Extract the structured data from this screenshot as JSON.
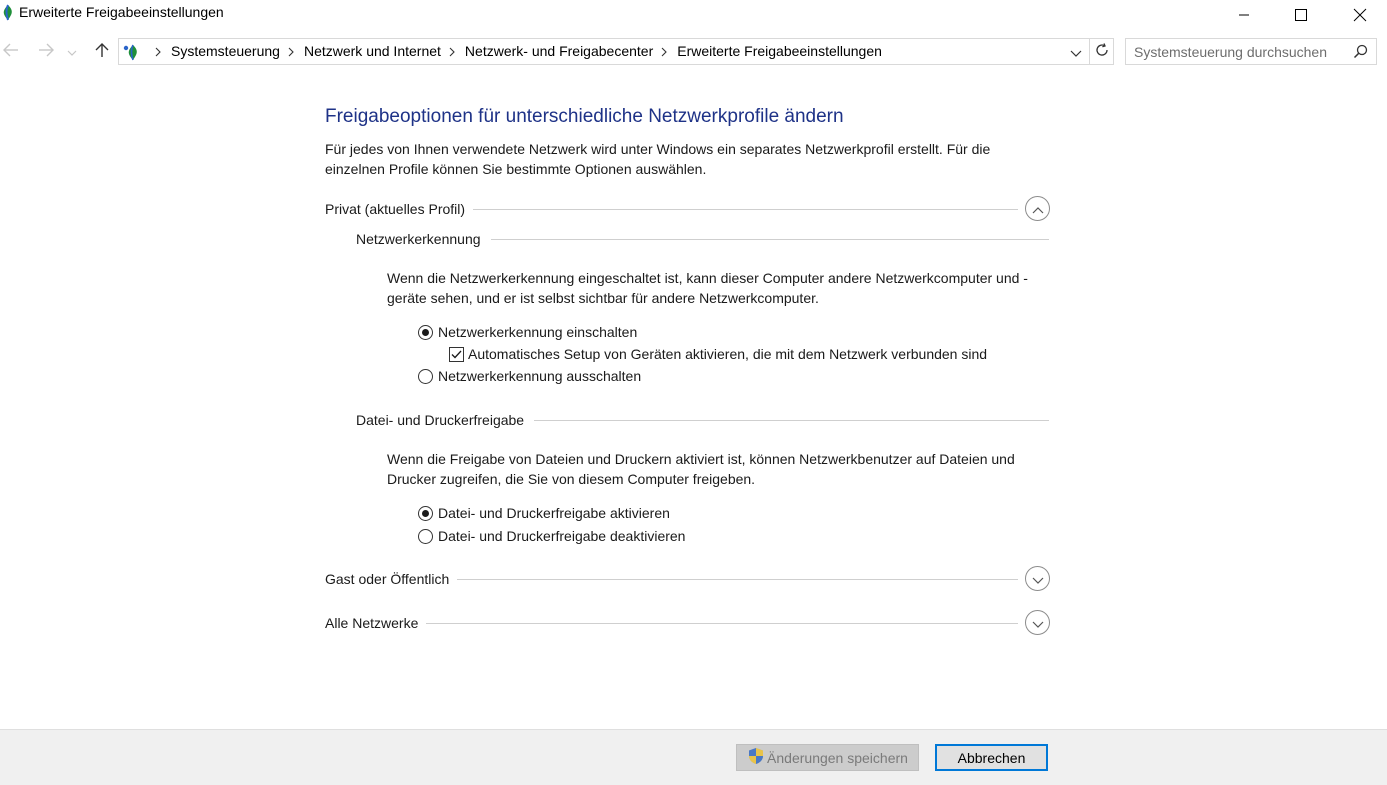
{
  "window": {
    "title": "Erweiterte Freigabeeinstellungen"
  },
  "address_bar": {
    "breadcrumbs": [
      "Systemsteuerung",
      "Netzwerk und Internet",
      "Netzwerk- und Freigabecenter",
      "Erweiterte Freigabeeinstellungen"
    ]
  },
  "search": {
    "placeholder": "Systemsteuerung durchsuchen"
  },
  "main": {
    "title": "Freigabeoptionen für unterschiedliche Netzwerkprofile ändern",
    "intro": "Für jedes von Ihnen verwendete Netzwerk wird unter Windows ein separates Netzwerkprofil erstellt. Für die einzelnen Profile können Sie bestimmte Optionen auswählen.",
    "profiles": {
      "private": {
        "label": "Privat (aktuelles Profil)",
        "expanded": true,
        "discovery": {
          "label": "Netzwerkerkennung",
          "description": "Wenn die Netzwerkerkennung eingeschaltet ist, kann dieser Computer andere Netzwerkcomputer und -geräte sehen, und er ist selbst sichtbar für andere Netzwerkcomputer.",
          "option_on": "Netzwerkerkennung einschalten",
          "auto_setup": "Automatisches Setup von Geräten aktivieren, die mit dem Netzwerk verbunden sind",
          "option_off": "Netzwerkerkennung ausschalten",
          "selected": "on",
          "auto_setup_checked": true
        },
        "file_sharing": {
          "label": "Datei- und Druckerfreigabe",
          "description": "Wenn die Freigabe von Dateien und Druckern aktiviert ist, können Netzwerkbenutzer auf Dateien und Drucker zugreifen, die Sie von diesem Computer freigeben.",
          "option_on": "Datei- und Druckerfreigabe aktivieren",
          "option_off": "Datei- und Druckerfreigabe deaktivieren",
          "selected": "on"
        }
      },
      "guest": {
        "label": "Gast oder Öffentlich",
        "expanded": false
      },
      "all": {
        "label": "Alle Netzwerke",
        "expanded": false
      }
    }
  },
  "footer": {
    "save_label": "Änderungen speichern",
    "cancel_label": "Abbrechen"
  },
  "icons": {
    "app": "network-globe-icon",
    "back": "arrow-left-icon",
    "forward": "arrow-right-icon",
    "recent": "chevron-down-icon",
    "up": "arrow-up-icon",
    "refresh": "refresh-icon",
    "search": "search-icon",
    "shield": "uac-shield-icon"
  },
  "colors": {
    "title_blue": "#1e3287",
    "accent": "#0078d7"
  }
}
